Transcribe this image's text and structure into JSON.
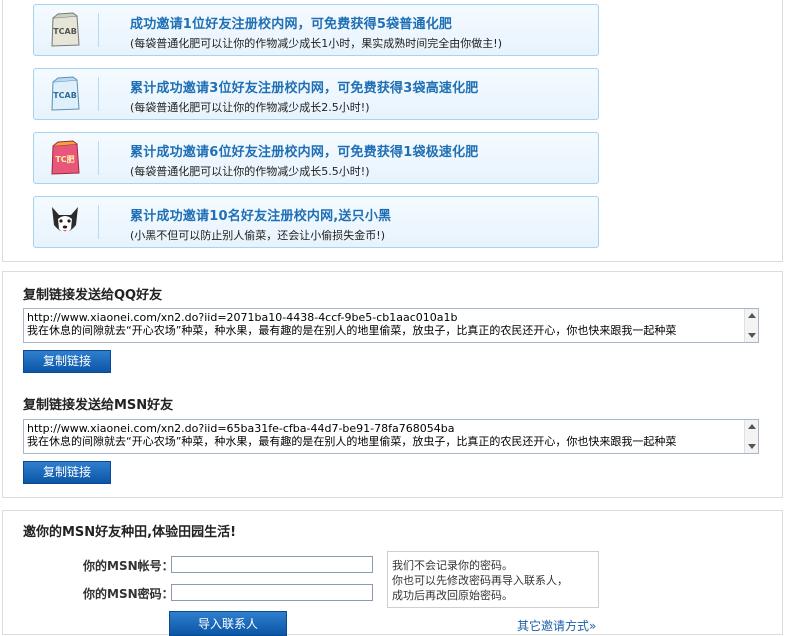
{
  "rewards": [
    {
      "icon": "fertilizer-bag-normal-icon",
      "title": "成功邀请1位好友注册校内网，可免费获得5袋普通化肥",
      "desc": "(每袋普通化肥可以让你的作物减少成长1小时，果实成熟时间完全由你做主!)",
      "bag_label": "TCAB"
    },
    {
      "icon": "fertilizer-bag-fast-icon",
      "title": "累计成功邀请3位好友注册校内网，可免费获得3袋高速化肥",
      "desc": "(每袋普通化肥可以让你的作物减少成长2.5小时!)",
      "bag_label": "TCAB"
    },
    {
      "icon": "fertilizer-bag-extreme-icon",
      "title": "累计成功邀请6位好友注册校内网，可免费获得1袋极速化肥",
      "desc": "(每袋普通化肥可以让你的作物减少成长5.5小时!)",
      "bag_label": "TC肥"
    },
    {
      "icon": "husky-dog-icon",
      "title": "累计成功邀请10名好友注册校内网,送只小黑",
      "desc": "(小黑不但可以防止别人偷菜，还会让小偷损失金币!)"
    }
  ],
  "qq": {
    "title": "复制链接发送给QQ好友",
    "url": "http://www.xiaonei.com/xn2.do?iid=2071ba10-4438-4ccf-9be5-cb1aac010a1b",
    "message": "我在休息的间隙就去“开心农场”种菜，种水果，最有趣的是在别人的地里偷菜，放虫子，比真正的农民还开心，你也快来跟我一起种菜",
    "button": "复制链接"
  },
  "msn_link": {
    "title": "复制链接发送给MSN好友",
    "url": "http://www.xiaonei.com/xn2.do?iid=65ba31fe-cfba-44d7-be91-78fa768054ba",
    "message": "我在休息的间隙就去“开心农场”种菜，种水果，最有趣的是在别人的地里偷菜，放虫子，比真正的农民还开心，你也快来跟我一起种菜",
    "button": "复制链接"
  },
  "msn_invite": {
    "title": "邀你的MSN好友种田,体验田园生活!",
    "account_label": "你的MSN帐号：",
    "password_label": "你的MSN密码：",
    "account_value": "",
    "password_value": "",
    "note_lines": [
      "我们不会记录你的密码。",
      "你也可以先修改密码再导入联系人，",
      "成功后再改回原始密码。"
    ],
    "import_button": "导入联系人",
    "other_link": "其它邀请方式»"
  },
  "colors": {
    "accent": "#1f6fb5",
    "button": "#0c55a6",
    "reward_border": "#a9d2ef"
  }
}
